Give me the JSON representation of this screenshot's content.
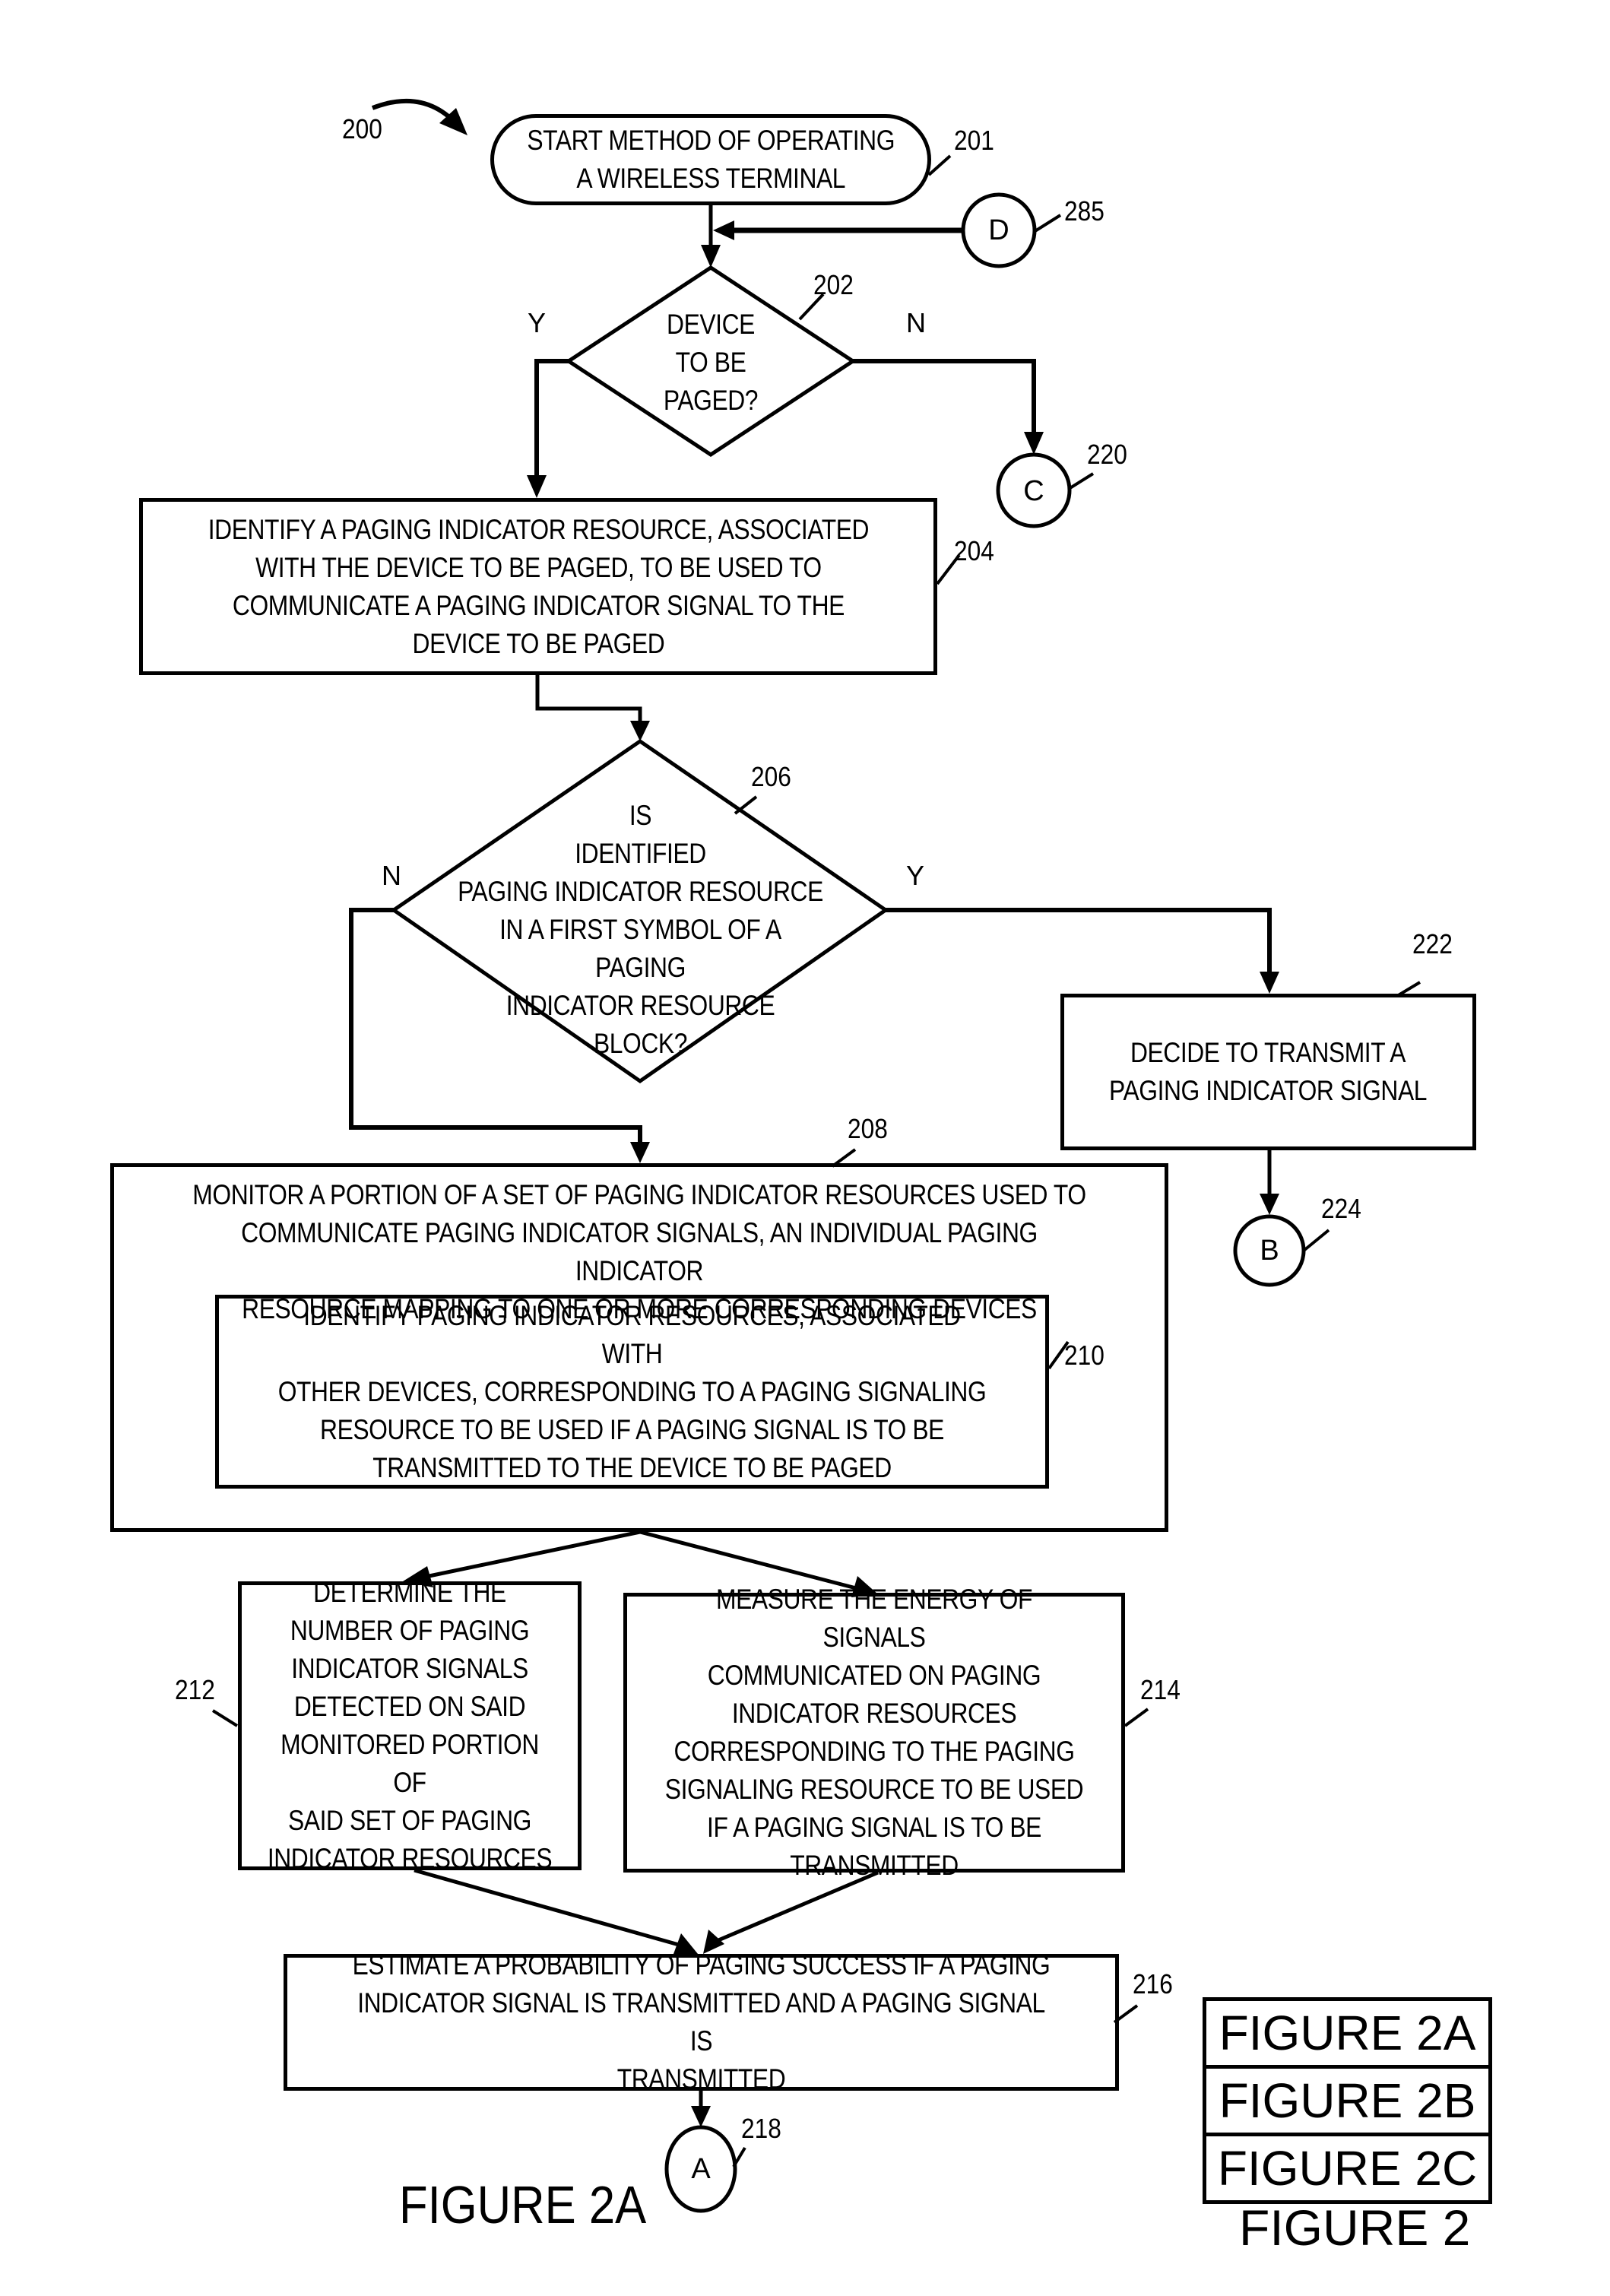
{
  "figure": {
    "ref": "200",
    "caption": "FIGURE 2A"
  },
  "nodes": {
    "start": {
      "ref": "201",
      "text": "START METHOD OF OPERATING\nA WIRELESS TERMINAL"
    },
    "d202": {
      "ref": "202",
      "text": "DEVICE\nTO BE\nPAGED?",
      "yes": "Y",
      "no": "N"
    },
    "b204": {
      "ref": "204",
      "text": "IDENTIFY A PAGING INDICATOR RESOURCE, ASSOCIATED\nWITH THE DEVICE TO BE PAGED, TO BE USED TO\nCOMMUNICATE A PAGING INDICATOR SIGNAL TO THE\nDEVICE TO BE PAGED"
    },
    "d206": {
      "ref": "206",
      "text": "IS\nIDENTIFIED\nPAGING INDICATOR RESOURCE\nIN A FIRST SYMBOL OF A PAGING\nINDICATOR RESOURCE\nBLOCK?",
      "yes": "Y",
      "no": "N"
    },
    "b208": {
      "ref": "208",
      "text": "MONITOR A PORTION OF A SET OF PAGING INDICATOR RESOURCES USED TO\nCOMMUNICATE PAGING INDICATOR SIGNALS, AN INDIVIDUAL PAGING INDICATOR\nRESOURCE MAPPING TO ONE OR MORE CORRESPONDING DEVICES"
    },
    "b210": {
      "ref": "210",
      "text": "IDENTIFY PAGING INDICATOR RESOURCES, ASSOCIATED WITH\nOTHER DEVICES, CORRESPONDING TO A PAGING SIGNALING\nRESOURCE TO BE USED IF A PAGING SIGNAL IS TO BE\nTRANSMITTED TO THE DEVICE TO BE PAGED"
    },
    "b212": {
      "ref": "212",
      "text": "DETERMINE THE\nNUMBER OF PAGING\nINDICATOR SIGNALS\nDETECTED ON SAID\nMONITORED PORTION OF\nSAID SET OF PAGING\nINDICATOR RESOURCES"
    },
    "b214": {
      "ref": "214",
      "text": "MEASURE THE ENERGY OF SIGNALS\nCOMMUNICATED ON PAGING\nINDICATOR RESOURCES\nCORRESPONDING TO THE  PAGING\nSIGNALING RESOURCE TO BE USED\nIF A PAGING SIGNAL IS TO BE\nTRANSMITTED"
    },
    "b216": {
      "ref": "216",
      "text": "ESTIMATE A PROBABILITY OF PAGING SUCCESS IF A PAGING\nINDICATOR SIGNAL IS TRANSMITTED AND A PAGING SIGNAL IS\nTRANSMITTED"
    },
    "b222": {
      "ref": "222",
      "text": "DECIDE TO TRANSMIT A\nPAGING INDICATOR SIGNAL"
    }
  },
  "connectors": {
    "D": {
      "ref": "285",
      "label": "D"
    },
    "C": {
      "ref": "220",
      "label": "C"
    },
    "B": {
      "ref": "224",
      "label": "B"
    },
    "A": {
      "ref": "218",
      "label": "A"
    }
  },
  "figure_key": {
    "rows": [
      "FIGURE 2A",
      "FIGURE 2B",
      "FIGURE 2C"
    ],
    "caption": "FIGURE 2"
  }
}
